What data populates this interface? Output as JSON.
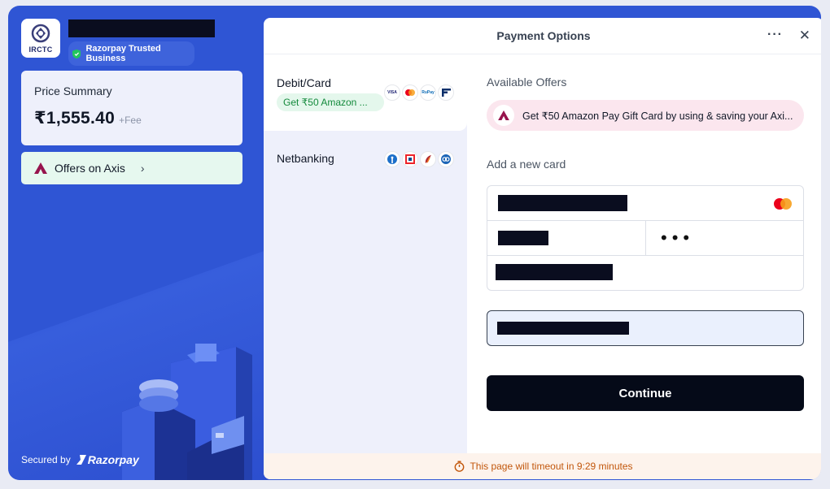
{
  "merchant": {
    "logo_text": "IRCTC",
    "trusted_label": "Razorpay Trusted Business"
  },
  "price_summary": {
    "title": "Price Summary",
    "amount": "₹1,555.40",
    "fee": "+Fee"
  },
  "offers_link": {
    "label": "Offers on Axis",
    "chevron": "›"
  },
  "footer_left": {
    "secured_by": "Secured by",
    "brand": "Razorpay"
  },
  "header": {
    "title": "Payment Options",
    "more": "···",
    "close": "✕"
  },
  "methods": [
    {
      "label": "Debit/Card",
      "chip": "Get ₹50 Amazon ...",
      "icons": [
        "visa-icon",
        "mastercard-icon",
        "rupay-icon",
        "bajaj-icon"
      ]
    },
    {
      "label": "Netbanking",
      "icons": [
        "sbi-icon",
        "hdfc-icon",
        "icici-icon",
        "axis-icon"
      ]
    }
  ],
  "offers": {
    "title": "Available Offers",
    "banner": "Get ₹50 Amazon Pay Gift Card by using & saving your Axi..."
  },
  "new_card": {
    "title": "Add a new card",
    "cvv_mask": "•••"
  },
  "continue_label": "Continue",
  "timeout": {
    "text": "This page will timeout in 9:29 minutes"
  },
  "colors": {
    "brand_blue": "#2f55d4",
    "offer_green_bg": "#e6f8ef",
    "offer_pink_bg": "#fbe6ee",
    "timeout_orange": "#c2570c",
    "continue_bg": "#050a18"
  }
}
